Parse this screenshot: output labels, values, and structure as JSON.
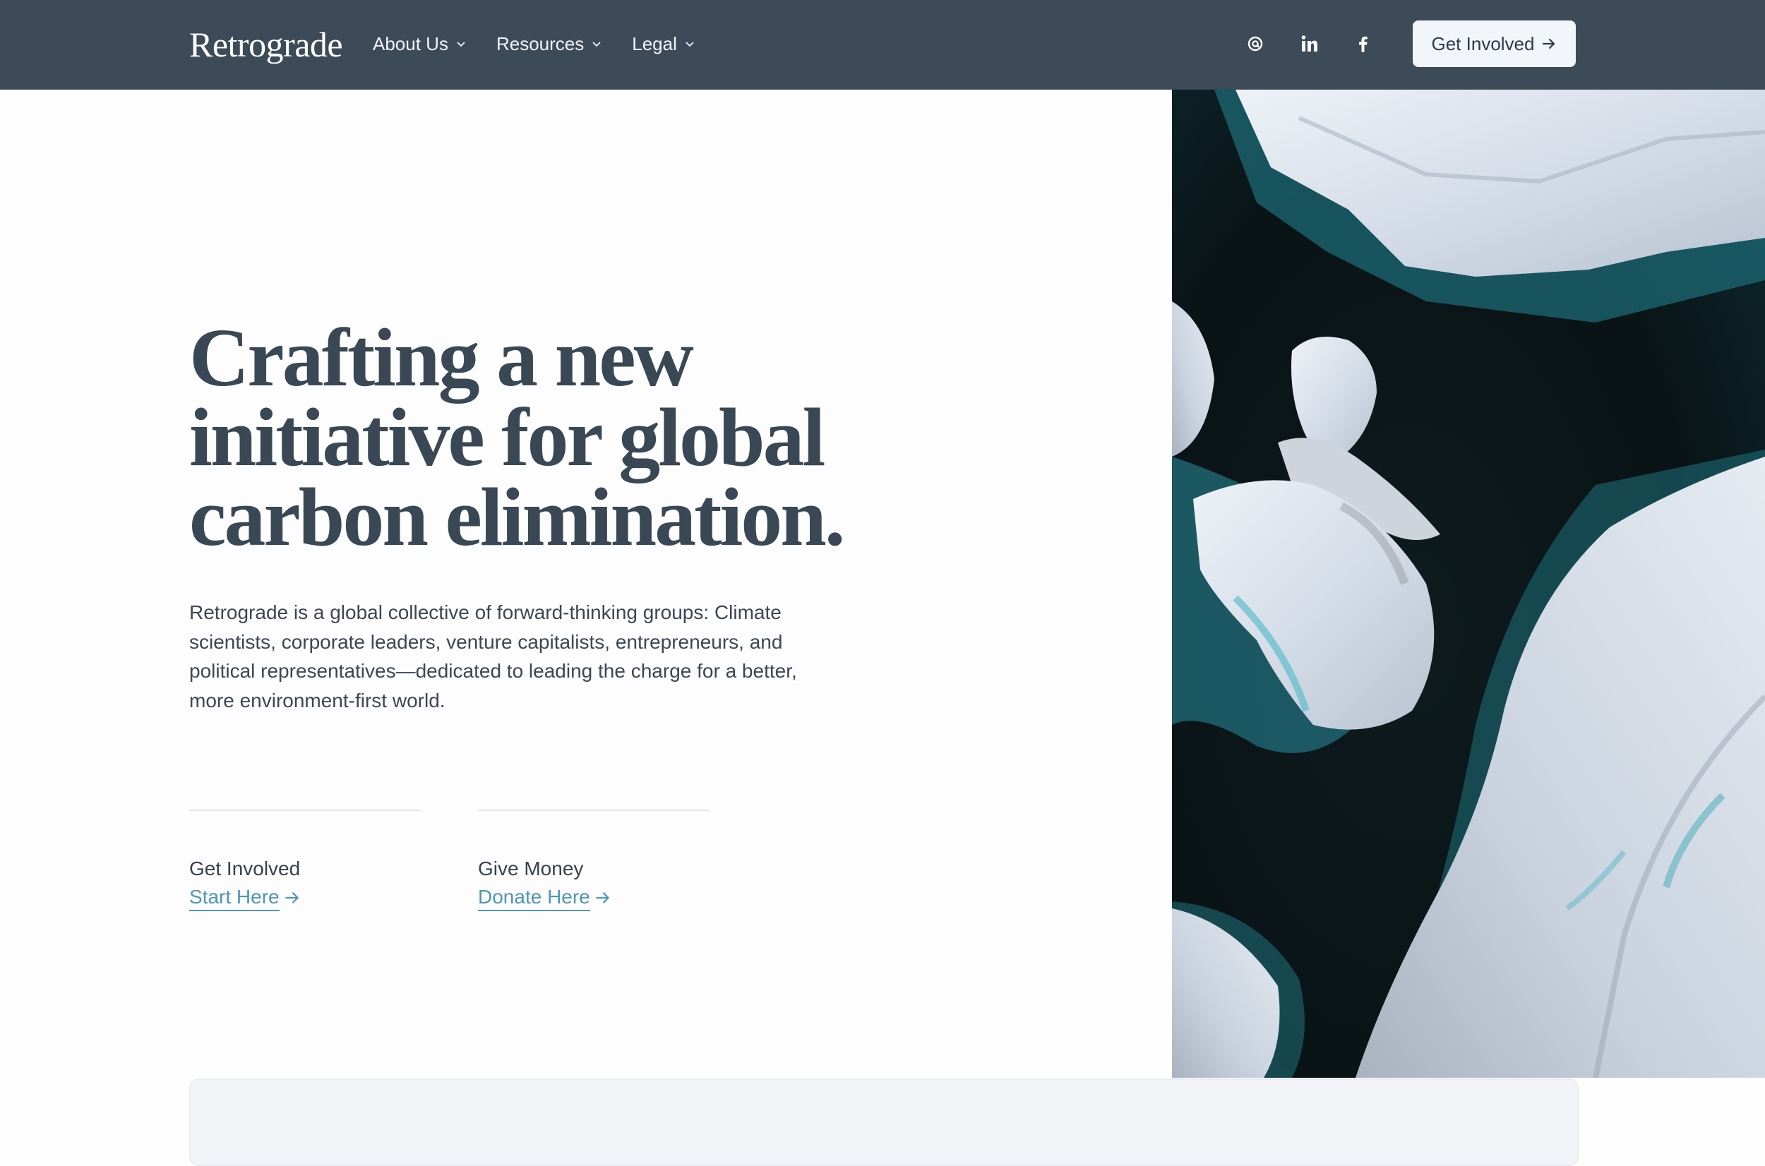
{
  "nav": {
    "brand": "Retrograde",
    "menu": [
      {
        "label": "About Us",
        "icon": "chevron-down-icon"
      },
      {
        "label": "Resources",
        "icon": "chevron-down-icon"
      },
      {
        "label": "Legal",
        "icon": "chevron-down-icon"
      }
    ],
    "social": [
      "threads-icon",
      "linkedin-icon",
      "facebook-icon"
    ],
    "cta_label": "Get Involved",
    "cta_icon": "arrow-right-icon"
  },
  "hero": {
    "headline_lines": [
      "Crafting a new",
      "initiative for global",
      "carbon elimination."
    ],
    "intro": "Retrograde is a global collective of forward-thinking groups: Climate scientists, corporate leaders, venture capitalists, entrepreneurs, and political representatives—dedicated to leading the charge for a better, more environment-first world.",
    "actions": [
      {
        "title": "Get Involved",
        "link": "Start Here"
      },
      {
        "title": "Give Money",
        "link": "Donate Here"
      }
    ],
    "image": "aerial-icebergs-photo"
  },
  "colors": {
    "nav_bg": "#3d4a57",
    "link": "#4e97b1",
    "headline": "#3a4855",
    "card_bg": "#f2f4f8"
  }
}
